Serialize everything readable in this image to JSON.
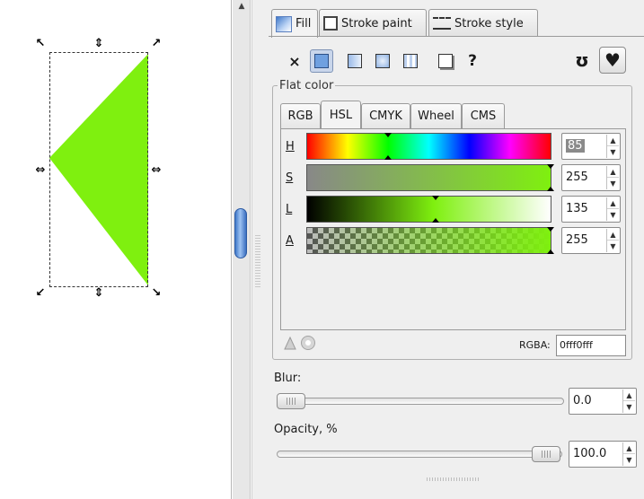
{
  "tabs": [
    {
      "label": "Fill",
      "icon": "fill-icon",
      "active": true
    },
    {
      "label": "Stroke paint",
      "icon": "stroke-paint-icon",
      "active": false
    },
    {
      "label": "Stroke style",
      "icon": "stroke-style-icon",
      "active": false
    }
  ],
  "fill_modes": {
    "none_symbol": "×",
    "unknown_symbol": "?",
    "selected": "flat-color",
    "items": [
      "no-paint-icon",
      "flat-color-icon",
      "linear-gradient-icon",
      "radial-gradient-icon",
      "pattern-icon",
      "swatch-icon",
      "unset-paint-icon"
    ]
  },
  "fill_rules": {
    "evenodd_symbol": "ʊ",
    "nonzero_symbol": "♥",
    "active": "nonzero"
  },
  "flat_color": {
    "title": "Flat color",
    "color_tabs": [
      {
        "label": "RGB",
        "active": false
      },
      {
        "label": "HSL",
        "active": true
      },
      {
        "label": "CMYK",
        "active": false
      },
      {
        "label": "Wheel",
        "active": false
      },
      {
        "label": "CMS",
        "active": false
      }
    ],
    "channels": [
      {
        "label": "H",
        "value": "85",
        "fraction": 0.333
      },
      {
        "label": "S",
        "value": "255",
        "fraction": 1.0
      },
      {
        "label": "L",
        "value": "135",
        "fraction": 0.529
      },
      {
        "label": "A",
        "value": "255",
        "fraction": 1.0
      }
    ],
    "rgba_label": "RGBA:",
    "rgba_value": "0fff0fff"
  },
  "blur": {
    "label": "Blur:",
    "value": "0.0",
    "fraction": 0.0
  },
  "opacity": {
    "label": "Opacity, %",
    "value": "100.0",
    "fraction": 1.0
  },
  "colors": {
    "shape_fill": "#7ff00f",
    "accent": "#3f78c9",
    "panel_bg": "#efefef"
  }
}
